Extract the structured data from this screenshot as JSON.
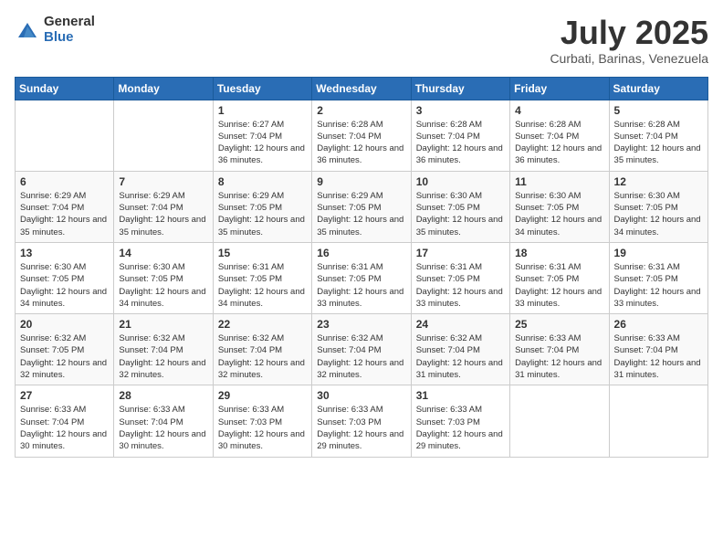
{
  "header": {
    "logo_general": "General",
    "logo_blue": "Blue",
    "month_title": "July 2025",
    "subtitle": "Curbati, Barinas, Venezuela"
  },
  "days_of_week": [
    "Sunday",
    "Monday",
    "Tuesday",
    "Wednesday",
    "Thursday",
    "Friday",
    "Saturday"
  ],
  "weeks": [
    [
      {
        "day": "",
        "info": ""
      },
      {
        "day": "",
        "info": ""
      },
      {
        "day": "1",
        "info": "Sunrise: 6:27 AM\nSunset: 7:04 PM\nDaylight: 12 hours and 36 minutes."
      },
      {
        "day": "2",
        "info": "Sunrise: 6:28 AM\nSunset: 7:04 PM\nDaylight: 12 hours and 36 minutes."
      },
      {
        "day": "3",
        "info": "Sunrise: 6:28 AM\nSunset: 7:04 PM\nDaylight: 12 hours and 36 minutes."
      },
      {
        "day": "4",
        "info": "Sunrise: 6:28 AM\nSunset: 7:04 PM\nDaylight: 12 hours and 36 minutes."
      },
      {
        "day": "5",
        "info": "Sunrise: 6:28 AM\nSunset: 7:04 PM\nDaylight: 12 hours and 35 minutes."
      }
    ],
    [
      {
        "day": "6",
        "info": "Sunrise: 6:29 AM\nSunset: 7:04 PM\nDaylight: 12 hours and 35 minutes."
      },
      {
        "day": "7",
        "info": "Sunrise: 6:29 AM\nSunset: 7:04 PM\nDaylight: 12 hours and 35 minutes."
      },
      {
        "day": "8",
        "info": "Sunrise: 6:29 AM\nSunset: 7:05 PM\nDaylight: 12 hours and 35 minutes."
      },
      {
        "day": "9",
        "info": "Sunrise: 6:29 AM\nSunset: 7:05 PM\nDaylight: 12 hours and 35 minutes."
      },
      {
        "day": "10",
        "info": "Sunrise: 6:30 AM\nSunset: 7:05 PM\nDaylight: 12 hours and 35 minutes."
      },
      {
        "day": "11",
        "info": "Sunrise: 6:30 AM\nSunset: 7:05 PM\nDaylight: 12 hours and 34 minutes."
      },
      {
        "day": "12",
        "info": "Sunrise: 6:30 AM\nSunset: 7:05 PM\nDaylight: 12 hours and 34 minutes."
      }
    ],
    [
      {
        "day": "13",
        "info": "Sunrise: 6:30 AM\nSunset: 7:05 PM\nDaylight: 12 hours and 34 minutes."
      },
      {
        "day": "14",
        "info": "Sunrise: 6:30 AM\nSunset: 7:05 PM\nDaylight: 12 hours and 34 minutes."
      },
      {
        "day": "15",
        "info": "Sunrise: 6:31 AM\nSunset: 7:05 PM\nDaylight: 12 hours and 34 minutes."
      },
      {
        "day": "16",
        "info": "Sunrise: 6:31 AM\nSunset: 7:05 PM\nDaylight: 12 hours and 33 minutes."
      },
      {
        "day": "17",
        "info": "Sunrise: 6:31 AM\nSunset: 7:05 PM\nDaylight: 12 hours and 33 minutes."
      },
      {
        "day": "18",
        "info": "Sunrise: 6:31 AM\nSunset: 7:05 PM\nDaylight: 12 hours and 33 minutes."
      },
      {
        "day": "19",
        "info": "Sunrise: 6:31 AM\nSunset: 7:05 PM\nDaylight: 12 hours and 33 minutes."
      }
    ],
    [
      {
        "day": "20",
        "info": "Sunrise: 6:32 AM\nSunset: 7:05 PM\nDaylight: 12 hours and 32 minutes."
      },
      {
        "day": "21",
        "info": "Sunrise: 6:32 AM\nSunset: 7:04 PM\nDaylight: 12 hours and 32 minutes."
      },
      {
        "day": "22",
        "info": "Sunrise: 6:32 AM\nSunset: 7:04 PM\nDaylight: 12 hours and 32 minutes."
      },
      {
        "day": "23",
        "info": "Sunrise: 6:32 AM\nSunset: 7:04 PM\nDaylight: 12 hours and 32 minutes."
      },
      {
        "day": "24",
        "info": "Sunrise: 6:32 AM\nSunset: 7:04 PM\nDaylight: 12 hours and 31 minutes."
      },
      {
        "day": "25",
        "info": "Sunrise: 6:33 AM\nSunset: 7:04 PM\nDaylight: 12 hours and 31 minutes."
      },
      {
        "day": "26",
        "info": "Sunrise: 6:33 AM\nSunset: 7:04 PM\nDaylight: 12 hours and 31 minutes."
      }
    ],
    [
      {
        "day": "27",
        "info": "Sunrise: 6:33 AM\nSunset: 7:04 PM\nDaylight: 12 hours and 30 minutes."
      },
      {
        "day": "28",
        "info": "Sunrise: 6:33 AM\nSunset: 7:04 PM\nDaylight: 12 hours and 30 minutes."
      },
      {
        "day": "29",
        "info": "Sunrise: 6:33 AM\nSunset: 7:03 PM\nDaylight: 12 hours and 30 minutes."
      },
      {
        "day": "30",
        "info": "Sunrise: 6:33 AM\nSunset: 7:03 PM\nDaylight: 12 hours and 29 minutes."
      },
      {
        "day": "31",
        "info": "Sunrise: 6:33 AM\nSunset: 7:03 PM\nDaylight: 12 hours and 29 minutes."
      },
      {
        "day": "",
        "info": ""
      },
      {
        "day": "",
        "info": ""
      }
    ]
  ]
}
